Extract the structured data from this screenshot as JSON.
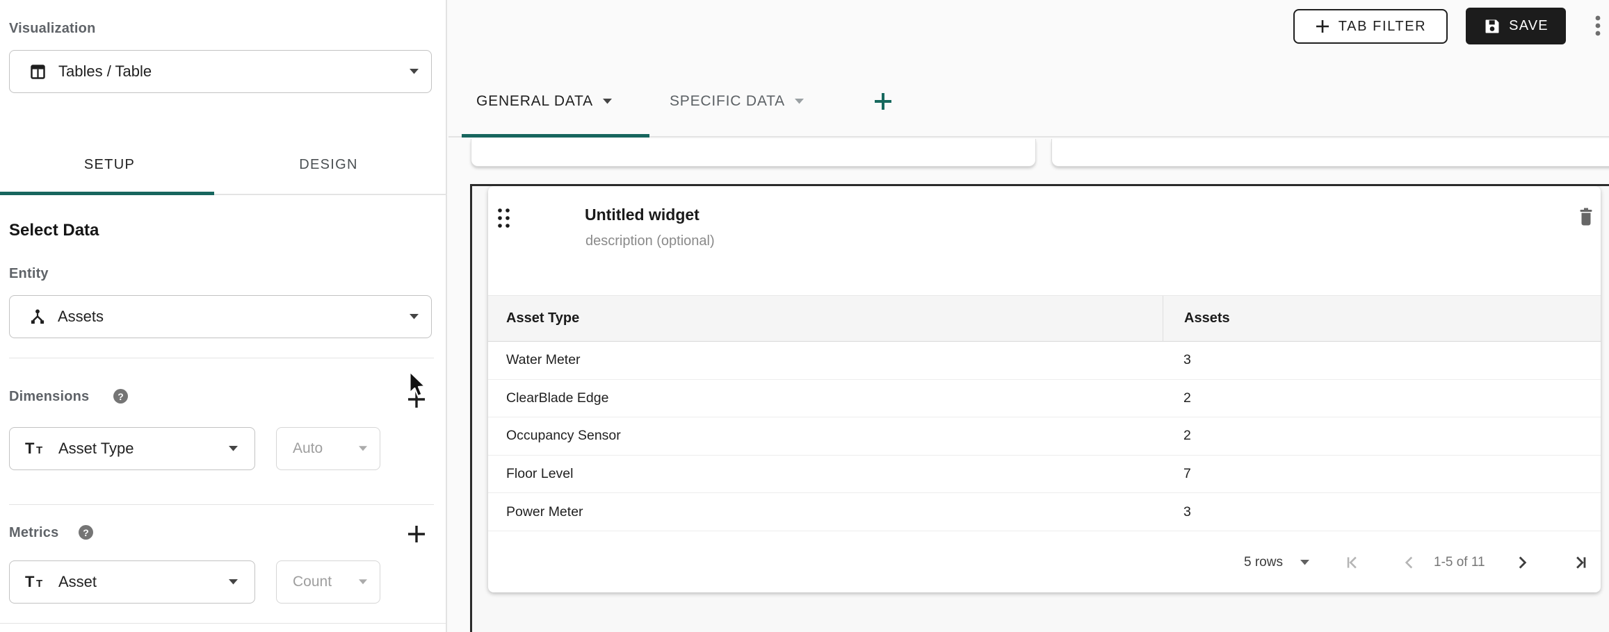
{
  "sidebar": {
    "visualization_label": "Visualization",
    "visualization_value": "Tables / Table",
    "setup_tab": "SETUP",
    "design_tab": "DESIGN",
    "select_data_title": "Select Data",
    "entity_label": "Entity",
    "entity_value": "Assets",
    "dimensions_label": "Dimensions",
    "dimension_field": "Asset Type",
    "dimension_bucket": "Auto",
    "metrics_label": "Metrics",
    "metric_field": "Asset",
    "metric_aggregate": "Count"
  },
  "topbar": {
    "tab_filter_label": "TAB FILTER",
    "save_label": "SAVE"
  },
  "data_tabs": {
    "general_label": "GENERAL DATA",
    "specific_label": "SPECIFIC DATA"
  },
  "widget": {
    "title": "Untitled widget",
    "description_placeholder": "description (optional)"
  },
  "table": {
    "columns": [
      "Asset Type",
      "Assets"
    ],
    "rows": [
      {
        "asset_type": "Water Meter",
        "assets": "3"
      },
      {
        "asset_type": "ClearBlade Edge",
        "assets": "2"
      },
      {
        "asset_type": "Occupancy Sensor",
        "assets": "2"
      },
      {
        "asset_type": "Floor Level",
        "assets": "7"
      },
      {
        "asset_type": "Power Meter",
        "assets": "3"
      }
    ]
  },
  "pagination": {
    "rows_per_page": "5 rows",
    "range_label": "1-5 of 11"
  },
  "colors": {
    "accent_teal": "#17665e",
    "add_green": "#17695e",
    "save_button_bg": "#1c1c1c",
    "canvas_outline": "#2c2c2c"
  }
}
